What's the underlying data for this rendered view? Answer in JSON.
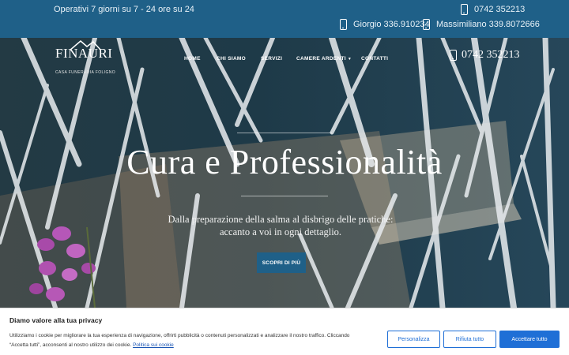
{
  "topbar": {
    "hours": "Operativi 7 giorni su 7 - 24 ore su 24",
    "phone_main": "0742 352213",
    "contact_1": "Giorgio 336.910234",
    "contact_2": "Massimiliano 339.8072666",
    "icon": "phone-icon",
    "bg_color": "#1f6088"
  },
  "logo": {
    "brand": "FINAURI",
    "subtitle": "CASA FUNERARIA FOLIGNO"
  },
  "nav": {
    "items": [
      {
        "label": "HOME"
      },
      {
        "label": "CHI SIAMO"
      },
      {
        "label": "SERVIZI"
      },
      {
        "label": "CAMERE ARDENTI"
      },
      {
        "label": "CONTATTI"
      }
    ],
    "phone": "0742 352213"
  },
  "hero": {
    "headline": "Cura e Professionalità",
    "tagline_line1": "Dalla preparazione della salma al disbrigo delle pratiche:",
    "tagline_line2": "accanto a voi in ogni dettaglio.",
    "cta": "SCOPRI DI PIÙ"
  },
  "cookie": {
    "title": "Diamo valore alla tua privacy",
    "text_line1": "Utilizziamo i cookie per migliorare la tua esperienza di navigazione, offrirti pubblicità o contenuti personalizzati e analizzare il nostro traffico. Cliccando",
    "text_line2": "“Accetta tutti”, acconsenti al nostro utilizzo dei cookie.",
    "policy_link": "Politica sui cookie",
    "btn_customize": "Personalizza",
    "btn_reject": "Rifiuta tutto",
    "btn_accept": "Accettare tutto",
    "accent": "#1f6fd6"
  }
}
